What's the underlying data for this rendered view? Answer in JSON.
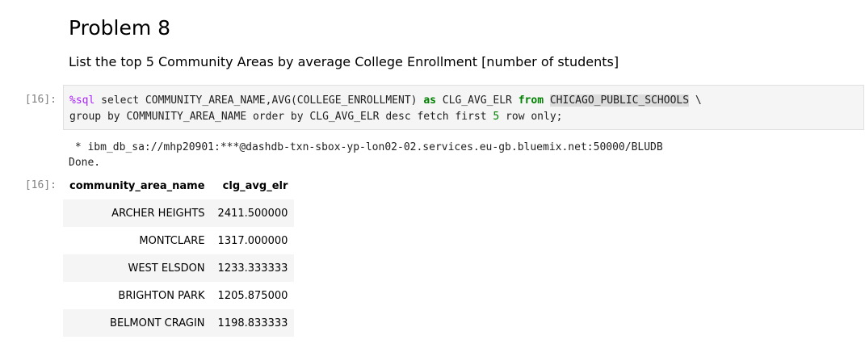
{
  "heading": "Problem 8",
  "question": "List the top 5 Community Areas by average College Enrollment [number of students]",
  "input_prompt": "[16]:",
  "output_prompt": "[16]:",
  "code": {
    "line1": {
      "magic": "%sql",
      "t1": " select COMMUNITY_AREA_NAME,AVG(COLLEGE_ENROLLMENT) ",
      "kw_as": "as",
      "t2": " CLG_AVG_ELR ",
      "kw_from": "from",
      "t3": " ",
      "table_name": "CHICAGO_PUBLIC_SCHOOLS",
      "t4": " \\"
    },
    "line2": {
      "t1": "group by COMMUNITY_AREA_NAME order by CLG_AVG_ELR desc fetch first ",
      "num": "5",
      "t2": " row only;"
    }
  },
  "stdout": {
    "line1": " * ibm_db_sa://mhp20901:***@dashdb-txn-sbox-yp-lon02-02.services.eu-gb.bluemix.net:50000/BLUDB",
    "line2": "Done."
  },
  "table": {
    "headers": [
      "community_area_name",
      "clg_avg_elr"
    ],
    "rows": [
      [
        "ARCHER HEIGHTS",
        "2411.500000"
      ],
      [
        "MONTCLARE",
        "1317.000000"
      ],
      [
        "WEST ELSDON",
        "1233.333333"
      ],
      [
        "BRIGHTON PARK",
        "1205.875000"
      ],
      [
        "BELMONT CRAGIN",
        "1198.833333"
      ]
    ]
  }
}
